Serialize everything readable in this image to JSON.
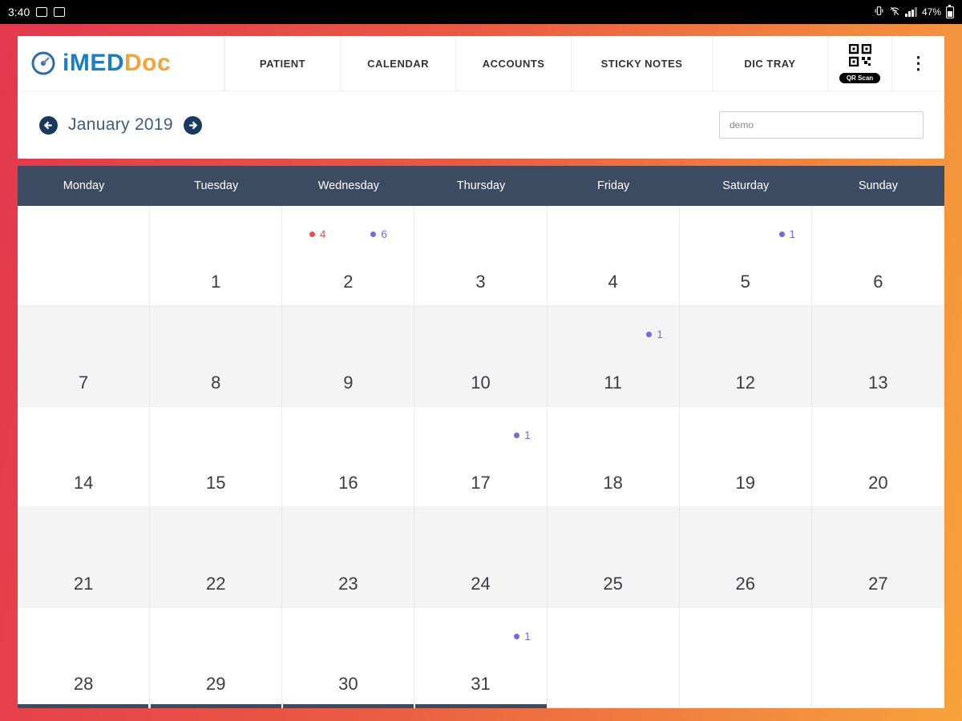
{
  "colors": {
    "brand-blue": "#1b7ec2",
    "brand-orange": "#f2a33c",
    "header-navy": "#3c4b61",
    "title-blue": "#3e5d7e",
    "badge-red": "#df5555",
    "badge-purple": "#7569e0",
    "gradient-start": "#e4374e",
    "gradient-mid": "#ea5b42",
    "gradient-end": "#f7a23c"
  },
  "status_bar": {
    "time": "3:40",
    "battery_percent": "47%"
  },
  "header": {
    "logo": {
      "imed": "iMED",
      "doc": "Doc"
    },
    "nav": [
      {
        "label": "PATIENT"
      },
      {
        "label": "CALENDAR"
      },
      {
        "label": "ACCOUNTS"
      },
      {
        "label": "STICKY NOTES"
      },
      {
        "label": "DIC TRAY"
      }
    ],
    "qr_label": "QR Scan",
    "menu_glyph": "⋮"
  },
  "toolbar": {
    "month_title": "January 2019",
    "search_value": "demo"
  },
  "calendar": {
    "weekdays": [
      "Monday",
      "Tuesday",
      "Wednesday",
      "Thursday",
      "Friday",
      "Saturday",
      "Sunday"
    ],
    "weeks": [
      [
        {
          "day": ""
        },
        {
          "day": "1"
        },
        {
          "day": "2",
          "badges": [
            {
              "count": "4",
              "color": "badge-red"
            },
            {
              "count": "6",
              "color": "badge-purple"
            }
          ]
        },
        {
          "day": "3"
        },
        {
          "day": "4"
        },
        {
          "day": "5",
          "badges": [
            {
              "count": "1",
              "color": "badge-purple"
            }
          ]
        },
        {
          "day": "6"
        }
      ],
      [
        {
          "day": "7"
        },
        {
          "day": "8"
        },
        {
          "day": "9"
        },
        {
          "day": "10"
        },
        {
          "day": "11",
          "badges": [
            {
              "count": "1",
              "color": "badge-purple"
            }
          ]
        },
        {
          "day": "12"
        },
        {
          "day": "13"
        }
      ],
      [
        {
          "day": "14"
        },
        {
          "day": "15"
        },
        {
          "day": "16"
        },
        {
          "day": "17",
          "badges": [
            {
              "count": "1",
              "color": "badge-purple"
            }
          ]
        },
        {
          "day": "18"
        },
        {
          "day": "19"
        },
        {
          "day": "20"
        }
      ],
      [
        {
          "day": "21"
        },
        {
          "day": "22"
        },
        {
          "day": "23"
        },
        {
          "day": "24"
        },
        {
          "day": "25"
        },
        {
          "day": "26"
        },
        {
          "day": "27"
        }
      ],
      [
        {
          "day": "28"
        },
        {
          "day": "29"
        },
        {
          "day": "30"
        },
        {
          "day": "31",
          "badges": [
            {
              "count": "1",
              "color": "badge-purple"
            }
          ]
        },
        {
          "day": ""
        },
        {
          "day": ""
        },
        {
          "day": ""
        }
      ]
    ]
  }
}
